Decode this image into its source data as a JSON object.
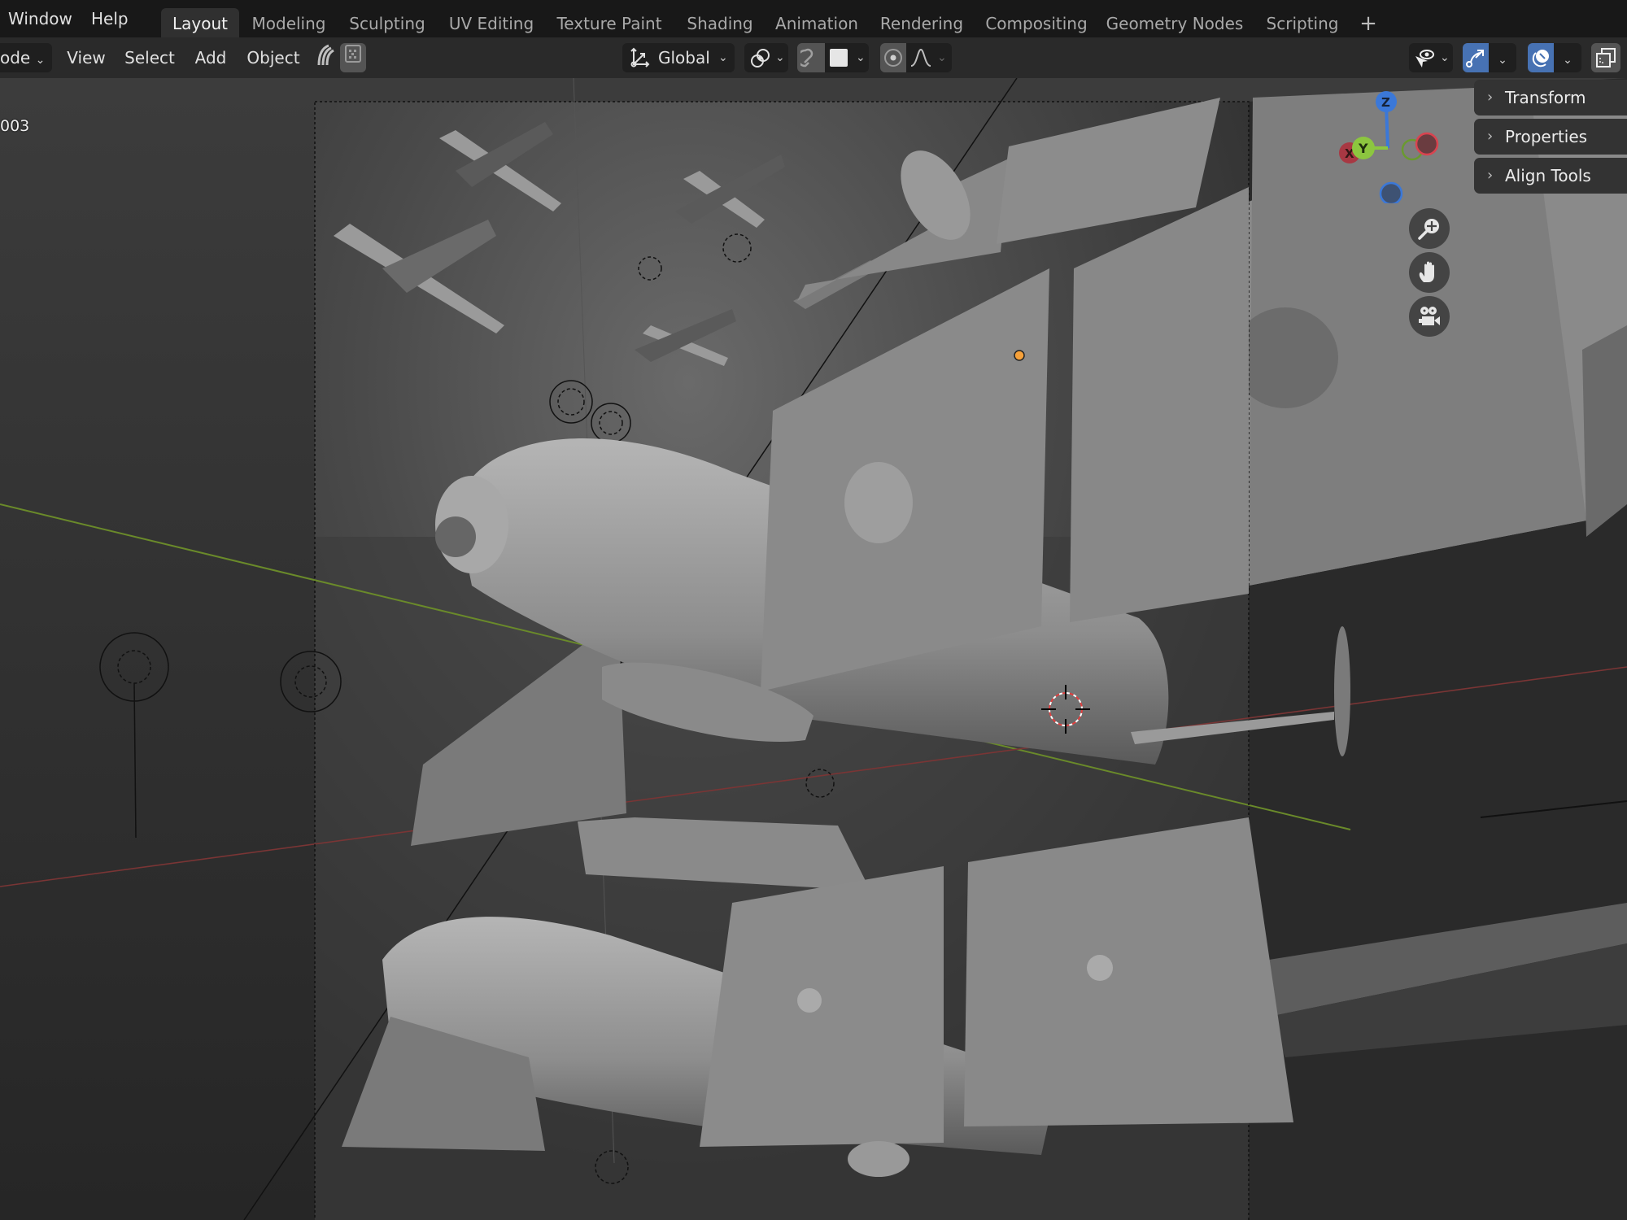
{
  "topbar": {
    "menus": [
      "Window",
      "Help"
    ],
    "workspace_tabs": [
      {
        "label": "Layout",
        "active": true
      },
      {
        "label": "Modeling",
        "active": false
      },
      {
        "label": "Sculpting",
        "active": false
      },
      {
        "label": "UV Editing",
        "active": false
      },
      {
        "label": "Texture Paint",
        "active": false
      },
      {
        "label": "Shading",
        "active": false
      },
      {
        "label": "Animation",
        "active": false
      },
      {
        "label": "Rendering",
        "active": false
      },
      {
        "label": "Compositing",
        "active": false
      },
      {
        "label": "Geometry Nodes",
        "active": false
      },
      {
        "label": "Scripting",
        "active": false
      }
    ],
    "add_workspace": "+"
  },
  "toolbar": {
    "mode_label": "ode",
    "menus": [
      "View",
      "Select",
      "Add",
      "Object"
    ],
    "transform_orientation": "Global",
    "icons": {
      "gpencil": "grease-pencil-icon",
      "texture": "checker-icon",
      "orientation": "transform-orientation-icon",
      "pivot": "pivot-point-icon",
      "snap": "magnet-snap-icon",
      "snap_target": "snap-square-icon",
      "proportional": "proportional-edit-icon",
      "falloff": "falloff-curve-icon",
      "visibility": "selectability-eye-icon",
      "gizmo": "gizmo-toggle-icon",
      "overlay": "overlay-toggle-icon",
      "xray": "xray-toggle-icon"
    },
    "colors": {
      "toggle_active": "#4772b3"
    }
  },
  "viewport": {
    "object_name_partial": "003",
    "n_panel": [
      "Transform",
      "Properties",
      "Align Tools"
    ],
    "gizmo": {
      "axes": [
        {
          "label": "Z",
          "color": "#3b78d8"
        },
        {
          "label": "Y",
          "color": "#8cc63f"
        },
        {
          "label": "X",
          "color": "#d9434f"
        }
      ],
      "negative_axis_colors": {
        "x": "#d9434f",
        "y": "#6a9a2f",
        "z": "#3b78d8"
      }
    },
    "nav_buttons": [
      "zoom-icon",
      "pan-hand-icon",
      "camera-view-icon"
    ],
    "origin_dot_color": "#f6a13a",
    "axis_line_colors": {
      "x": "#8a3a3a",
      "y": "#6a8a2a"
    }
  }
}
